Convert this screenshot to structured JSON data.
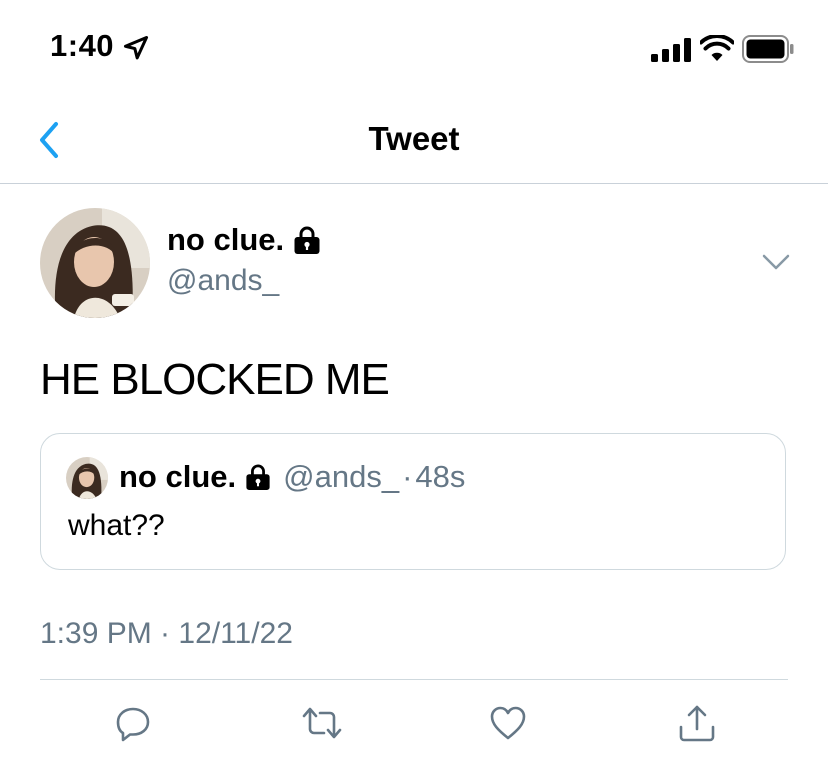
{
  "status_bar": {
    "time": "1:40",
    "icons": [
      "location-arrow-icon",
      "cellular-signal-icon",
      "wifi-icon",
      "battery-icon"
    ]
  },
  "nav": {
    "title": "Tweet",
    "back_icon": "chevron-left-icon"
  },
  "tweet": {
    "author": {
      "display_name": "no clue.",
      "handle": "@ands_",
      "protected_icon": "lock-icon"
    },
    "text": "HE BLOCKED ME",
    "quoted": {
      "display_name": "no clue.",
      "handle": "@ands_",
      "separator": "·",
      "time_ago": "48s",
      "text": "what??"
    },
    "timestamp": "1:39 PM · 12/11/22"
  },
  "actions": [
    "reply-icon",
    "retweet-icon",
    "like-icon",
    "share-icon"
  ],
  "colors": {
    "accent": "#1DA1F2",
    "secondary_text": "#657786",
    "divider": "#CFD9DE"
  }
}
